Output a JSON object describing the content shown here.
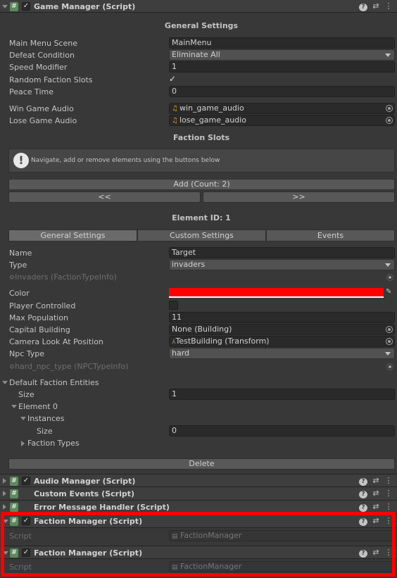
{
  "game_manager": {
    "title": "Game Manager (Script)",
    "general_settings_title": "General Settings",
    "fields": {
      "main_menu_scene": {
        "label": "Main Menu Scene",
        "value": "MainMenu"
      },
      "defeat_condition": {
        "label": "Defeat Condition",
        "value": "Eliminate All"
      },
      "speed_modifier": {
        "label": "Speed Modifier",
        "value": "1"
      },
      "random_faction_slots": {
        "label": "Random Faction Slots",
        "checked": true
      },
      "peace_time": {
        "label": "Peace Time",
        "value": "0"
      },
      "win_game_audio": {
        "label": "Win Game Audio",
        "value": "win_game_audio"
      },
      "lose_game_audio": {
        "label": "Lose Game Audio",
        "value": "lose_game_audio"
      }
    },
    "faction_slots_title": "Faction Slots",
    "help_text": "Navigate, add or remove elements using the buttons below",
    "add_button": "Add (Count: 2)",
    "prev_button": "<<",
    "next_button": ">>",
    "element_title": "Element ID: 1",
    "tabs": [
      "General Settings",
      "Custom Settings",
      "Events"
    ],
    "element": {
      "name": {
        "label": "Name",
        "value": "Target"
      },
      "type": {
        "label": "Type",
        "value": "invaders"
      },
      "type_ref": "Invaders (FactionTypeInfo)",
      "color": {
        "label": "Color",
        "value": "#ff0000"
      },
      "player_controlled": {
        "label": "Player Controlled",
        "checked": false
      },
      "max_population": {
        "label": "Max Population",
        "value": "11"
      },
      "capital_building": {
        "label": "Capital Building",
        "value": "None (Building)"
      },
      "camera_look_at": {
        "label": "Camera Look At Position",
        "value": "TestBuilding (Transform)"
      },
      "npc_type": {
        "label": "Npc Type",
        "value": "hard"
      },
      "npc_type_ref": "hard_npc_type (NPCTypeInfo)"
    },
    "default_entities": {
      "label": "Default Faction Entities",
      "size_label": "Size",
      "size_value": "1",
      "element0": "Element 0",
      "instances": "Instances",
      "instances_size_label": "Size",
      "instances_size_value": "0",
      "faction_types": "Faction Types"
    },
    "delete_button": "Delete"
  },
  "components": [
    {
      "title": "Audio Manager (Script)"
    },
    {
      "title": "Custom Events (Script)"
    },
    {
      "title": "Error Message Handler (Script)"
    },
    {
      "title": "Faction Manager (Script)",
      "script_label": "Script",
      "script_value": "FactionManager"
    },
    {
      "title": "Faction Manager (Script)",
      "script_label": "Script",
      "script_value": "FactionManager"
    }
  ],
  "icons": {
    "help": "help-icon",
    "presets": "presets-icon",
    "menu": "kebab-menu-icon"
  },
  "colors": {
    "highlight": "#ff0000",
    "panel": "#383838",
    "header": "#3e3e3e"
  }
}
